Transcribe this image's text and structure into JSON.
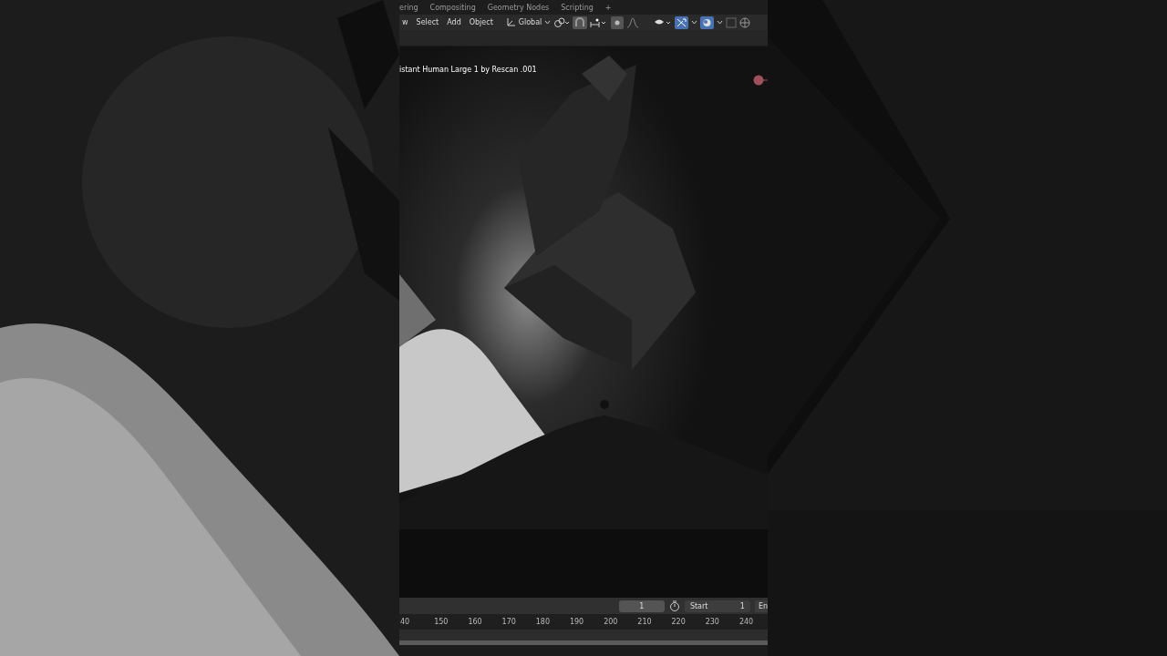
{
  "workspace_tabs": [
    {
      "label": "ering",
      "selected": false
    },
    {
      "label": "Compositing",
      "selected": false
    },
    {
      "label": "Geometry Nodes",
      "selected": false
    },
    {
      "label": "Scripting",
      "selected": false
    }
  ],
  "add_tab": "+",
  "menu": [
    "w",
    "Select",
    "Add",
    "Object"
  ],
  "orientation": "Global",
  "header_toggles": [
    {
      "kind": "snap",
      "on": true
    },
    {
      "kind": "proportional",
      "on": true
    },
    {
      "kind": "gizmo",
      "on": true
    },
    {
      "kind": "overlay",
      "on": true
    }
  ],
  "viewport": {
    "object_label": "istant Human Large 1 by Rescan .001"
  },
  "timeline": {
    "current_frame": "1",
    "start_label": "Start",
    "start_value": "1",
    "end_label": "En",
    "ruler": [
      "40",
      "150",
      "160",
      "170",
      "180",
      "190",
      "200",
      "210",
      "220",
      "230",
      "240"
    ]
  }
}
